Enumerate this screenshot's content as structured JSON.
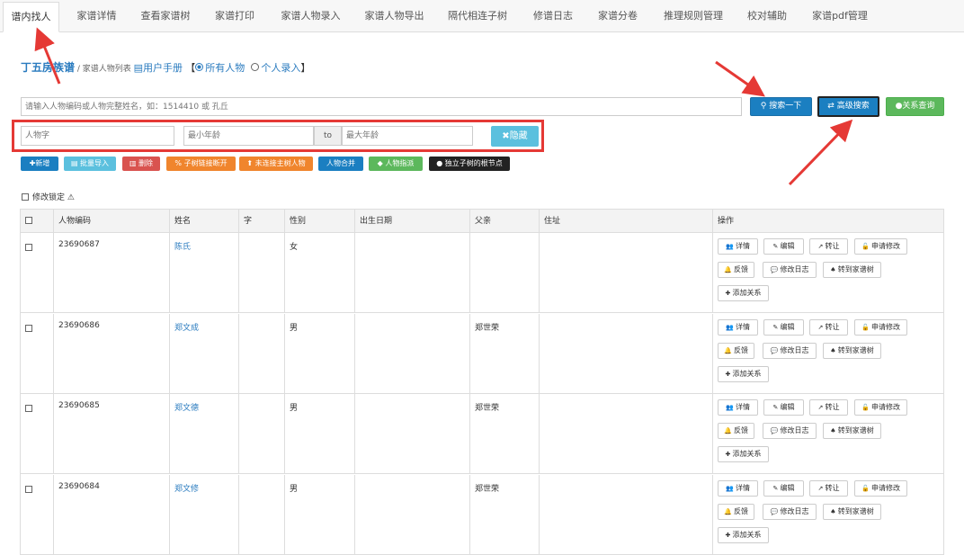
{
  "tabs": [
    {
      "label": "谱内找人"
    },
    {
      "label": "家谱详情"
    },
    {
      "label": "查看家谱树"
    },
    {
      "label": "家谱打印"
    },
    {
      "label": "家谱人物录入"
    },
    {
      "label": "家谱人物导出"
    },
    {
      "label": "隔代相连子树"
    },
    {
      "label": "修谱日志"
    },
    {
      "label": "家谱分卷"
    },
    {
      "label": "推理规则管理"
    },
    {
      "label": "校对辅助"
    },
    {
      "label": "家谱pdf管理"
    }
  ],
  "title": {
    "main": "丁五房族谱",
    "sub": " / 家谱人物列表 ",
    "manual": "用户手册",
    "bracket_open": "【",
    "opt_all": "所有人物",
    "opt_personal": "个人录入",
    "bracket_close": "】"
  },
  "search": {
    "placeholder": "请输入人物编码或人物完整姓名，如：1514410 或 孔丘",
    "search_btn": "搜索一下",
    "adv_btn": "高级搜索",
    "relation_btn": "关系查询"
  },
  "adv": {
    "name_placeholder": "人物字",
    "min_age_placeholder": "最小年龄",
    "to": "to",
    "max_age_placeholder": "最大年龄",
    "hide_btn": "隐藏"
  },
  "actions": {
    "new": "新增",
    "batch_import": "批量导入",
    "delete": "删除",
    "subtree_break": "子树链接断开",
    "connect_main": "未连接主树人物",
    "merge": "人物合并",
    "assign": "人物指派",
    "independent": "独立子树的根节点"
  },
  "lock_label": "修改锁定",
  "table": {
    "headers": [
      "人物编码",
      "姓名",
      "字",
      "性别",
      "出生日期",
      "父亲",
      "住址",
      "操作"
    ],
    "ops": [
      "详情",
      "编辑",
      "转让",
      "申请修改",
      "反馈",
      "修改日志",
      "转到家谱树",
      "添加关系"
    ],
    "rows": [
      {
        "code": "23690687",
        "name": "陈氏",
        "zi": "",
        "gender": "女",
        "birth": "",
        "father": "",
        "address": ""
      },
      {
        "code": "23690686",
        "name": "郑文成",
        "zi": "",
        "gender": "男",
        "birth": "",
        "father": "郑世荣",
        "address": ""
      },
      {
        "code": "23690685",
        "name": "郑文德",
        "zi": "",
        "gender": "男",
        "birth": "",
        "father": "郑世荣",
        "address": ""
      },
      {
        "code": "23690684",
        "name": "郑文修",
        "zi": "",
        "gender": "男",
        "birth": "",
        "father": "郑世荣",
        "address": ""
      }
    ]
  },
  "colors": {
    "accent": "#2a7bbf",
    "annotation_red": "#e53935"
  }
}
